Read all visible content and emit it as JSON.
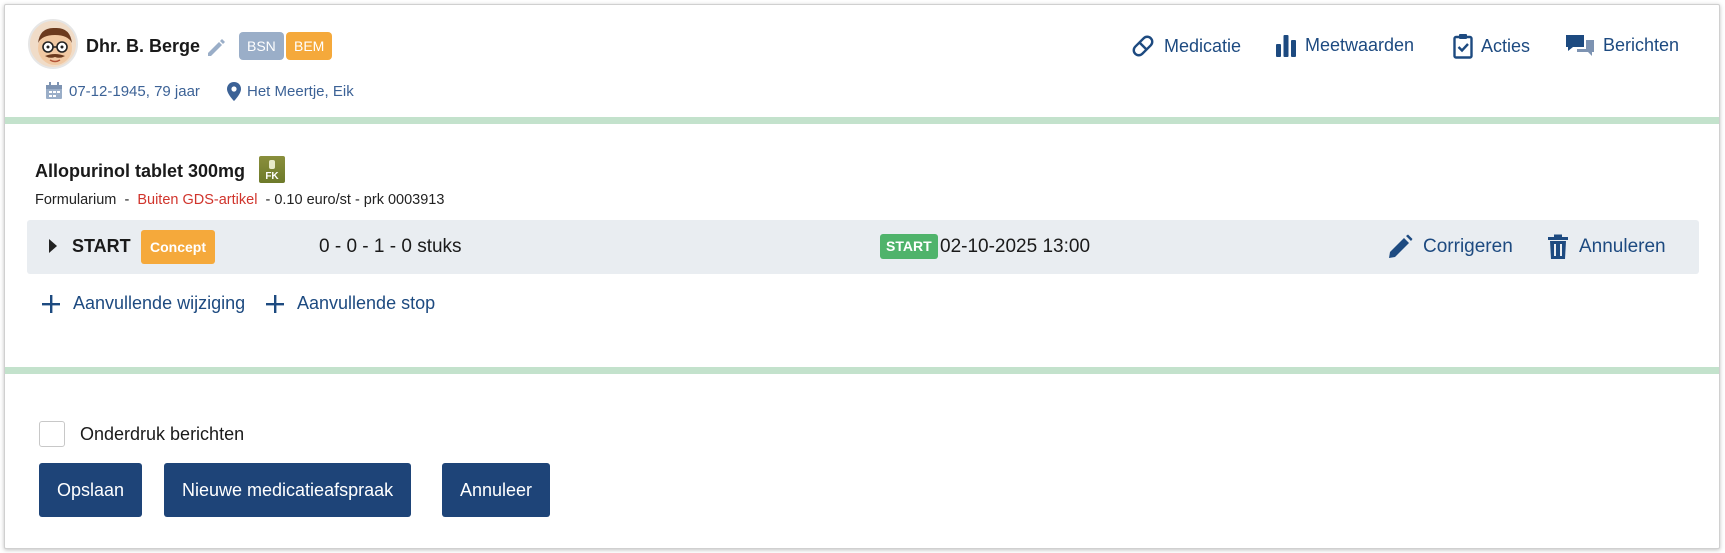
{
  "patient": {
    "name": "Dhr. B. Berge",
    "badges": [
      "BSN",
      "BEM"
    ],
    "dob": "07-12-1945, 79 jaar",
    "location": "Het Meertje, Eik"
  },
  "nav": {
    "items": [
      "Medicatie",
      "Meetwaarden",
      "Acties",
      "Berichten"
    ]
  },
  "drug": {
    "name": "Allopurinol tablet 300mg",
    "fk_label": "FK",
    "formularium": "Formularium",
    "separator1": "-",
    "gds": "Buiten GDS-artikel",
    "price_prk": "- 0.10 euro/st - prk 0003913"
  },
  "row": {
    "title": "START",
    "status": "Concept",
    "dose": "0 - 0 - 1 - 0 stuks",
    "start_badge": "START",
    "datetime": "02-10-2025 13:00",
    "correct_label": "Corrigeren",
    "cancel_label": "Annuleren"
  },
  "add_links": [
    "Aanvullende wijziging",
    "Aanvullende stop"
  ],
  "footer": {
    "checkbox_label": "Onderdruk berichten",
    "buttons": [
      "Opslaan",
      "Nieuwe medicatieafspraak",
      "Annuleer"
    ]
  },
  "colors": {
    "primary": "#1e4478",
    "link": "#1d4a80",
    "orange": "#f5a93b",
    "green": "#4fb36b",
    "separator": "#c3e2cc",
    "red": "#d0342c"
  }
}
